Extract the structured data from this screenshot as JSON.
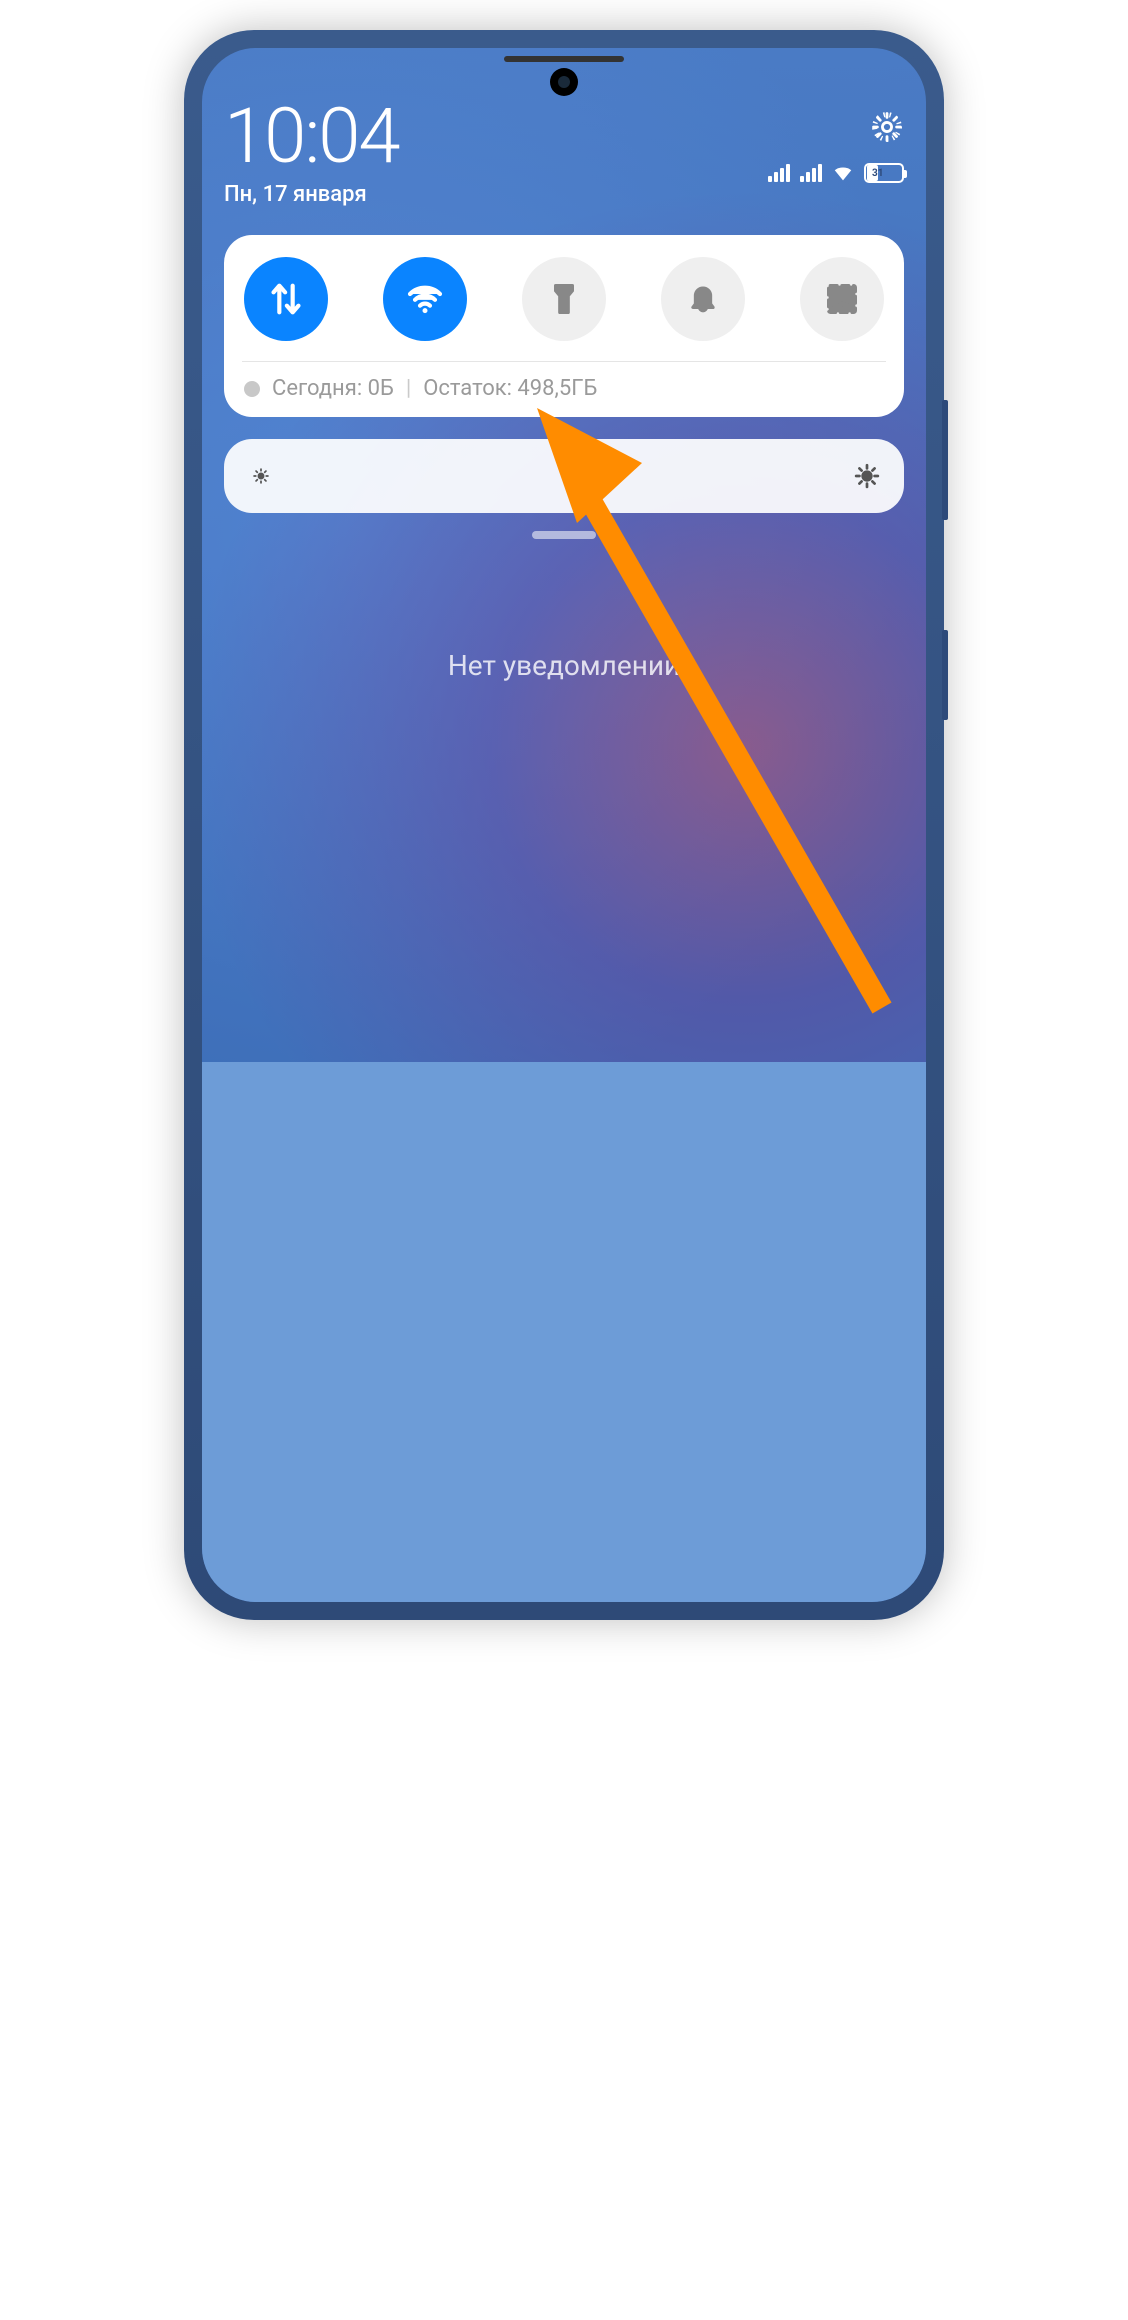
{
  "header": {
    "time": "10:04",
    "date": "Пн, 17 января",
    "battery_percent": "31",
    "battery_fill_pct": 31
  },
  "qs": {
    "toggles": [
      {
        "name": "mobile-data",
        "active": true,
        "icon": "data"
      },
      {
        "name": "wifi",
        "active": true,
        "icon": "wifi"
      },
      {
        "name": "flashlight",
        "active": false,
        "icon": "flashlight"
      },
      {
        "name": "do-not-disturb",
        "active": false,
        "icon": "bell"
      },
      {
        "name": "screenshot",
        "active": false,
        "icon": "scissors"
      }
    ],
    "usage_today_label": "Сегодня: 0Б",
    "usage_remaining_label": "Остаток: 498,5ГБ"
  },
  "notifications": {
    "empty_text": "Нет уведомлений"
  }
}
